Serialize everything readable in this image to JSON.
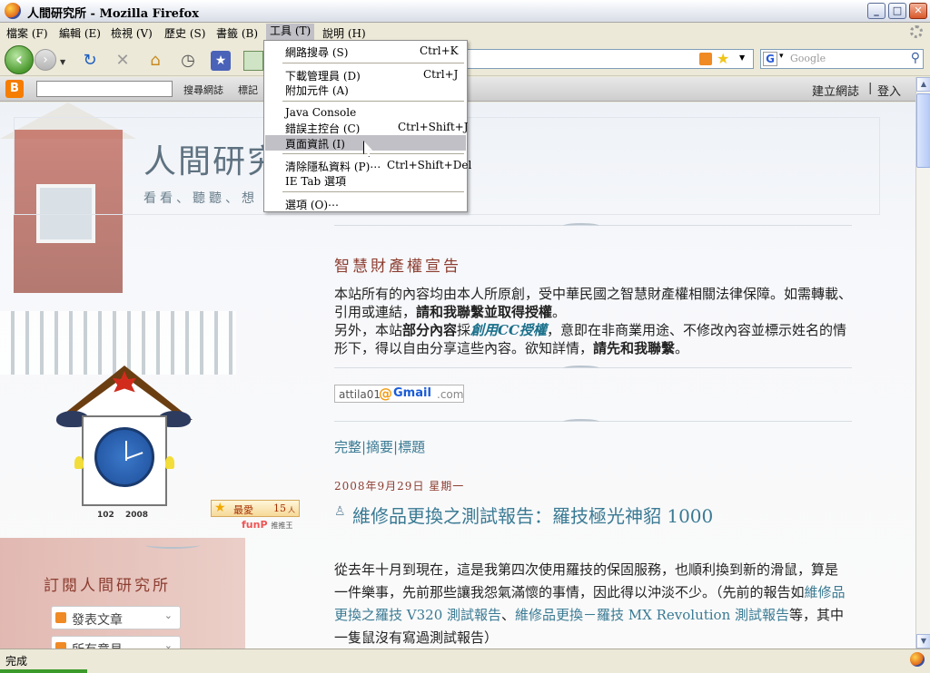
{
  "window": {
    "title": "人間研究所 - Mozilla Firefox",
    "min": "_",
    "max": "□",
    "close": "✕"
  },
  "menubar": {
    "items": [
      "檔案 (F)",
      "編輯 (E)",
      "檢視 (V)",
      "歷史 (S)",
      "書籤 (B)",
      "工具 (T)",
      "說明 (H)"
    ]
  },
  "toolbar": {
    "back": "‹",
    "forward": "›",
    "dropdown": "▼",
    "reload": "↻",
    "stop": "✕",
    "home": "⌂",
    "history": "◷",
    "bookmarks": "★",
    "url_drop": "▼"
  },
  "search": {
    "placeholder": "Google",
    "engine": "G",
    "engine_drop": "▾",
    "go": "⚲"
  },
  "bloggerbar": {
    "logo": "B",
    "search_btn": "搜尋網誌",
    "flag": "標記",
    "create": "建立網誌",
    "sep": "|",
    "login": "登入"
  },
  "tools_menu": {
    "items": [
      {
        "label": "網路搜尋 (S)",
        "key": "Ctrl+K"
      },
      {
        "label": "下載管理員 (D)",
        "key": "Ctrl+J"
      },
      {
        "label": "附加元件 (A)",
        "key": ""
      },
      {
        "label": "Java Console",
        "key": ""
      },
      {
        "label": "錯誤主控台 (C)",
        "key": "Ctrl+Shift+J"
      },
      {
        "label": "頁面資訊 (I)",
        "key": ""
      },
      {
        "label": "清除隱私資料 (P)⋯",
        "key": "Ctrl+Shift+Del"
      },
      {
        "label": "IE Tab 選項",
        "key": ""
      },
      {
        "label": "選項 (O)⋯",
        "key": ""
      }
    ]
  },
  "blog": {
    "title": "人間研究",
    "subtitle": "看看、聽聽、想"
  },
  "sidebar": {
    "clock_year_left": "102",
    "clock_year_right": "2008",
    "fav_label": "最愛",
    "fav_count": "15",
    "fav_unit": "人",
    "funp": "funP",
    "funp_sub": "推推王",
    "subscribe_title": "訂閱人間研究所",
    "subscribe_posts": "發表文章",
    "subscribe_comments": "所有意見"
  },
  "notice": {
    "title": "智慧財產權宣告",
    "p1_a": "本站所有的內容均由本人所原創，受中華民國之智慧財產權相關法律保障。如需轉載、引用或連結，",
    "p1_b": "請和我聯繫並取得授權",
    "p1_c": "。",
    "p2_a": "另外，本站",
    "p2_b": "部分內容",
    "p2_c": "採",
    "p2_link": "創用CC授權",
    "p2_d": "，意即在非商業用途、不修改內容並標示姓名的情形下，得以自由分享這些內容。欲知詳情，",
    "p2_e": "請先和我聯繫",
    "p2_f": "。"
  },
  "email": {
    "user": "attila01",
    "at": "@",
    "brand": "Gmail",
    "domain": ".com"
  },
  "view_links": "完整|摘要|標題",
  "post": {
    "date": "2008年9月29日 星期一",
    "title": "維修品更換之測試報告：羅技極光神貂 1000",
    "body_a": "從去年十月到現在，這是我第四次使用羅技的保固服務，也順利換到新的滑鼠，算是一件樂事，先前那些讓我怨氣滿懷的事情，因此得以沖淡不少。（先前的報告如",
    "link1": "維修品更換之羅技 V320 測試報告",
    "sep": "、",
    "link2": "維修品更換－羅技 MX Revolution 測試報告",
    "body_b": "等，其中一隻鼠沒有寫過測試報告）"
  },
  "status": {
    "text": "完成"
  }
}
